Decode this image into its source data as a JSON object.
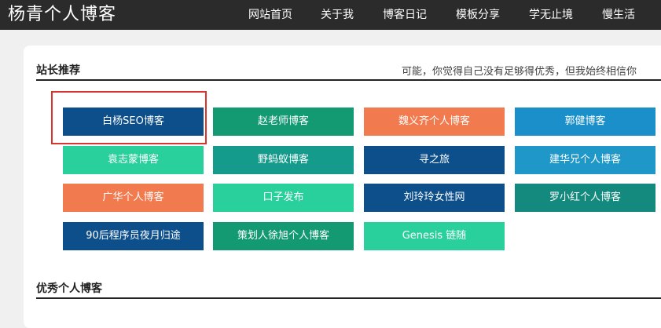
{
  "site": {
    "title": "杨青个人博客"
  },
  "nav": [
    {
      "label": "网站首页"
    },
    {
      "label": "关于我"
    },
    {
      "label": "博客日记"
    },
    {
      "label": "模板分享"
    },
    {
      "label": "学无止境"
    },
    {
      "label": "慢生活"
    }
  ],
  "recommend": {
    "title": "站长推荐",
    "motto": "可能，你觉得自己没有足够得优秀，但我始终相信你",
    "links": [
      {
        "label": "白杨SEO博客",
        "color": "#0c4f8a"
      },
      {
        "label": "赵老师博客",
        "color": "#149a73"
      },
      {
        "label": "魏义齐个人博客",
        "color": "#f17a4e"
      },
      {
        "label": "郭健博客",
        "color": "#1b8fc9"
      },
      {
        "label": "袁志蒙博客",
        "color": "#2ad09b"
      },
      {
        "label": "野蚂蚁博客",
        "color": "#159b8c"
      },
      {
        "label": "寻之旅",
        "color": "#0c4f8a"
      },
      {
        "label": "建华兄个人博客",
        "color": "#1f97c8"
      },
      {
        "label": "广华个人博客",
        "color": "#f17a4e"
      },
      {
        "label": "口子发布",
        "color": "#2ad09b"
      },
      {
        "label": "刘玲玲女性网",
        "color": "#0c4f8a"
      },
      {
        "label": "罗小红个人博客",
        "color": "#138a7d"
      },
      {
        "label": "90后程序员夜月归途",
        "color": "#0c4f8a"
      },
      {
        "label": "策划人徐旭个人博客",
        "color": "#149a73"
      },
      {
        "label": "Genesis 链随",
        "color": "#2ad09b"
      }
    ]
  },
  "excellent": {
    "title": "优秀个人博客"
  }
}
